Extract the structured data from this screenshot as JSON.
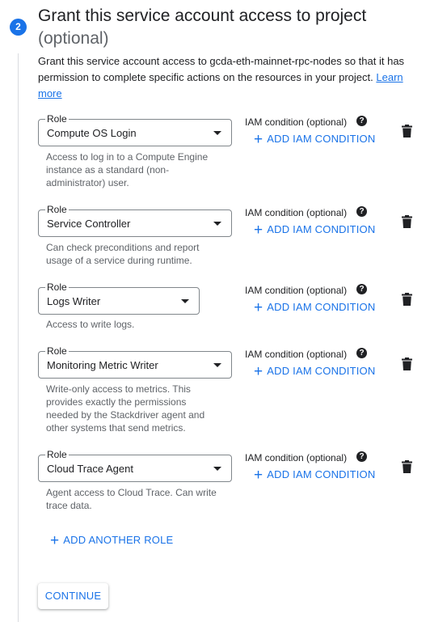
{
  "step": {
    "number": "2",
    "title": "Grant this service account access to project",
    "title_optional": "(optional)"
  },
  "description": {
    "text": "Grant this service account access to gcda-eth-mainnet-rpc-nodes so that it has permission to complete specific actions on the resources in your project. ",
    "link_label": "Learn more"
  },
  "roles": [
    {
      "field_label": "Role",
      "value": "Compute OS Login",
      "hint": "Access to log in to a Compute Engine instance as a standard (non-administrator) user.",
      "iam_label": "IAM condition (optional)",
      "add_condition_label": "ADD IAM CONDITION"
    },
    {
      "field_label": "Role",
      "value": "Service Controller",
      "hint": "Can check preconditions and report usage of a service during runtime.",
      "iam_label": "IAM condition (optional)",
      "add_condition_label": "ADD IAM CONDITION"
    },
    {
      "field_label": "Role",
      "value": "Logs Writer",
      "hint": "Access to write logs.",
      "iam_label": "IAM condition (optional)",
      "add_condition_label": "ADD IAM CONDITION"
    },
    {
      "field_label": "Role",
      "value": "Monitoring Metric Writer",
      "hint": "Write-only access to metrics. This provides exactly the permissions needed by the Stackdriver agent and other systems that send metrics.",
      "iam_label": "IAM condition (optional)",
      "add_condition_label": "ADD IAM CONDITION"
    },
    {
      "field_label": "Role",
      "value": "Cloud Trace Agent",
      "hint": "Agent access to Cloud Trace. Can write trace data.",
      "iam_label": "IAM condition (optional)",
      "add_condition_label": "ADD IAM CONDITION"
    }
  ],
  "actions": {
    "add_another_role": "ADD ANOTHER ROLE",
    "continue": "CONTINUE"
  },
  "icons": {
    "help": "help-icon",
    "delete": "trash-icon",
    "add": "plus-icon",
    "dropdown": "caret-down-icon"
  },
  "colors": {
    "accent": "#1a73e8",
    "text": "#202124",
    "secondary_text": "#5f6368"
  }
}
